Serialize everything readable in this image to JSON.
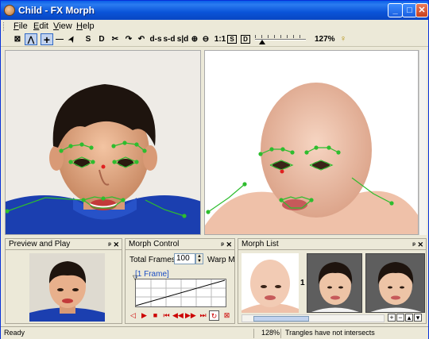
{
  "window": {
    "title": "Child - FX Morph"
  },
  "menu": [
    {
      "key": "F",
      "rest": "ile"
    },
    {
      "key": "E",
      "rest": "dit"
    },
    {
      "key": "V",
      "rest": "iew"
    },
    {
      "key": "H",
      "rest": "elp"
    }
  ],
  "toolbar": {
    "tools": [
      {
        "name": "select-box-tool",
        "label": "⊠"
      },
      {
        "name": "lines-tool",
        "label": "⋀",
        "selected": true
      },
      {
        "name": "point-add-tool",
        "label": "+",
        "selected": true
      },
      {
        "name": "line-tool",
        "label": "—"
      },
      {
        "name": "arrow-tool",
        "label": "➤"
      },
      {
        "name": "source-tool",
        "label": "S"
      },
      {
        "name": "destination-tool",
        "label": "D"
      },
      {
        "name": "cut-tool",
        "label": "✂"
      },
      {
        "name": "redo-tool",
        "label": "↷"
      },
      {
        "name": "undo-tool",
        "label": "↶"
      },
      {
        "name": "d-s-tool",
        "label": "d-s"
      },
      {
        "name": "s-d-tool",
        "label": "s-d"
      },
      {
        "name": "s-slash-d-tool",
        "label": "s|d"
      },
      {
        "name": "zoom-in-tool",
        "label": "⊕"
      },
      {
        "name": "zoom-out-tool",
        "label": "⊖"
      },
      {
        "name": "zoom-1to1-tool",
        "label": "1:1"
      },
      {
        "name": "fit-s-tool",
        "label": "S"
      },
      {
        "name": "fit-d-tool",
        "label": "D"
      }
    ],
    "zoom_label": "127%",
    "help_icon": "lightbulb-icon"
  },
  "panels": {
    "preview": {
      "title": "Preview and Play"
    },
    "morph_control": {
      "title": "Morph Control",
      "total_frames_label": "Total Frames",
      "total_frames_value": "100",
      "warp_label": "Warp M",
      "frame_label": "[1 Frame]"
    },
    "morph_list": {
      "title": "Morph List",
      "thumb_number": "1"
    }
  },
  "panel_controls": {
    "pin": "ᵖ",
    "close": "✕"
  },
  "status": {
    "left": "Ready",
    "zoom": "128%",
    "message": "Trangles have not intersects"
  },
  "colors": {
    "accent": "#0a54d8",
    "point": "#2ebd2e",
    "selected_point": "#e02020"
  }
}
